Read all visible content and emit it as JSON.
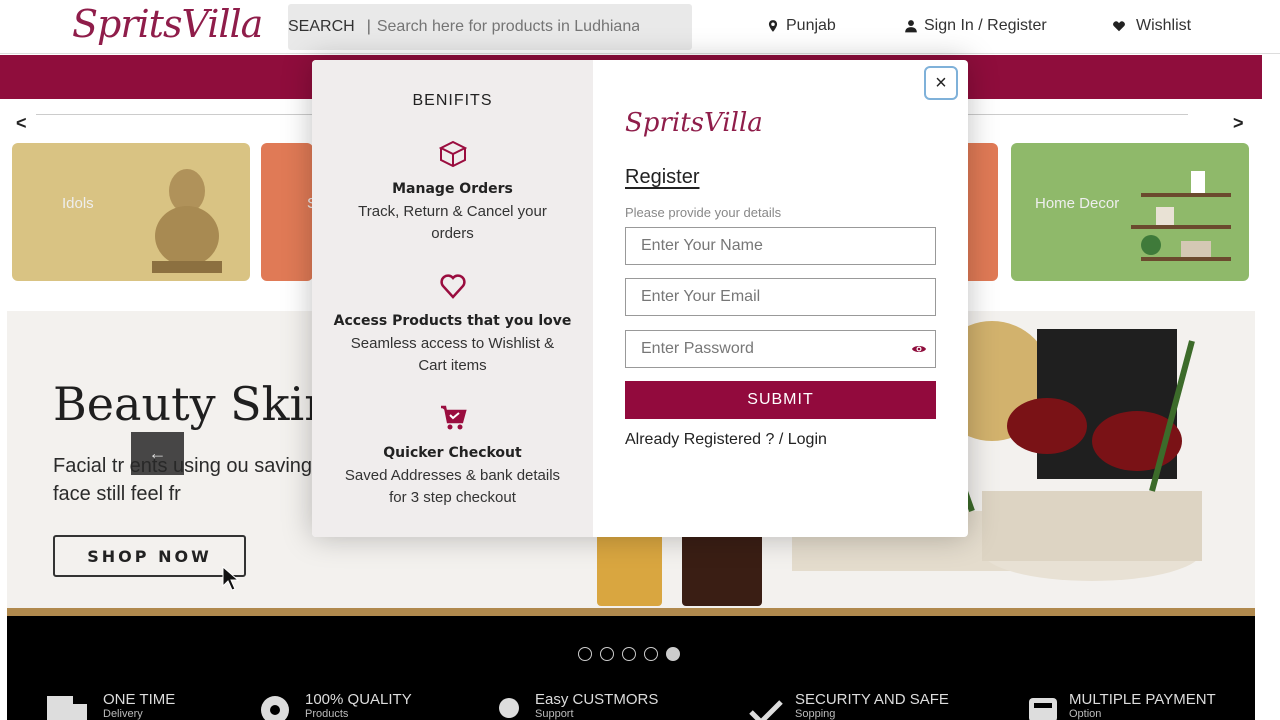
{
  "header": {
    "logo": "SpritsVilla",
    "search_label": "SEARCH",
    "search_separator": "|",
    "search_placeholder": "Search here for products in Ludhiana (I",
    "location": "Punjab",
    "sign_in": "Sign In / Register",
    "wishlist": "Wishlist"
  },
  "categories": {
    "prev": "<",
    "next": ">",
    "items": [
      {
        "label": "Idols",
        "color": "#d9c383"
      },
      {
        "label": "S",
        "color": "#e07a56"
      },
      {
        "label": "",
        "color": "#e07a56"
      },
      {
        "label": "Home Decor",
        "color": "#8fb96a"
      }
    ]
  },
  "hero": {
    "title": "Beauty Skinc",
    "text": "Facial tr    ents using ou saving the face still feel fr",
    "cta": "SHOP NOW",
    "prev_arrow": "←",
    "next_arrow": "→"
  },
  "footer": {
    "dots": 5,
    "features": [
      {
        "title": "ONE TIME",
        "sub": "Delivery"
      },
      {
        "title": "100% QUALITY",
        "sub": "Products"
      },
      {
        "title": "Easy CUSTMORS",
        "sub": "Support"
      },
      {
        "title": "SECURITY AND SAFE",
        "sub": "Sopping"
      },
      {
        "title": "MULTIPLE PAYMENT",
        "sub": "Option"
      }
    ]
  },
  "modal": {
    "benefits_title": "BENIFITS",
    "benefits": [
      {
        "title": "Manage Orders",
        "desc": "Track, Return & Cancel your orders"
      },
      {
        "title": "Access Products that you love",
        "desc": "Seamless access to Wishlist & Cart items"
      },
      {
        "title": "Quicker Checkout",
        "desc": "Saved Addresses & bank details for 3 step checkout"
      }
    ],
    "logo": "SpritsVilla",
    "title": "Register",
    "subtitle": "Please provide your details",
    "name_placeholder": "Enter Your Name",
    "email_placeholder": "Enter Your Email",
    "password_placeholder": "Enter Password",
    "submit": "SUBMIT",
    "login_link": "Already Registered ? / Login",
    "close": "×"
  },
  "colors": {
    "brand": "#8f0d3c",
    "benefits_bg": "#f0eded"
  }
}
